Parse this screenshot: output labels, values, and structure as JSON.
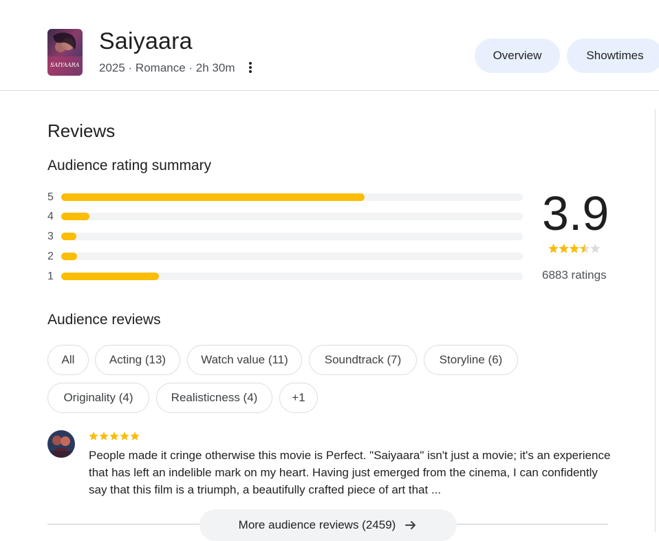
{
  "movie": {
    "title": "Saiyaara",
    "meta": "2025 · Romance · 2h 30m",
    "poster_text": "SAIYAARA"
  },
  "tabs": [
    {
      "label": "Overview"
    },
    {
      "label": "Showtimes"
    }
  ],
  "reviews": {
    "heading": "Reviews",
    "summary_heading": "Audience rating summary",
    "distribution": [
      {
        "stars": "5",
        "fraction": 0.657
      },
      {
        "stars": "4",
        "fraction": 0.061
      },
      {
        "stars": "3",
        "fraction": 0.033
      },
      {
        "stars": "2",
        "fraction": 0.034
      },
      {
        "stars": "1",
        "fraction": 0.211
      }
    ],
    "average": "3.9",
    "average_stars": 3.5,
    "ratings_count": "6883 ratings",
    "audience_heading": "Audience reviews",
    "filters": [
      {
        "label": "All"
      },
      {
        "label": "Acting (13)"
      },
      {
        "label": "Watch value (11)"
      },
      {
        "label": "Soundtrack (7)"
      },
      {
        "label": "Storyline (6)"
      },
      {
        "label": "Originality (4)"
      },
      {
        "label": "Realisticness (4)"
      },
      {
        "label": "+1"
      }
    ],
    "review": {
      "stars": 5,
      "text": "People made it cringe otherwise this movie is Perfect. \"Saiyaara\" isn't just a movie; it's an experience that has left an indelible mark on my heart. Having just emerged from the cinema, I can confidently say that this film is a triumph, a beautifully crafted piece of art that ..."
    },
    "more_button": "More audience reviews (2459)"
  },
  "colors": {
    "star": "#fbbc04",
    "star_empty": "#dadce0",
    "pill_bg": "#e8f0fe"
  }
}
